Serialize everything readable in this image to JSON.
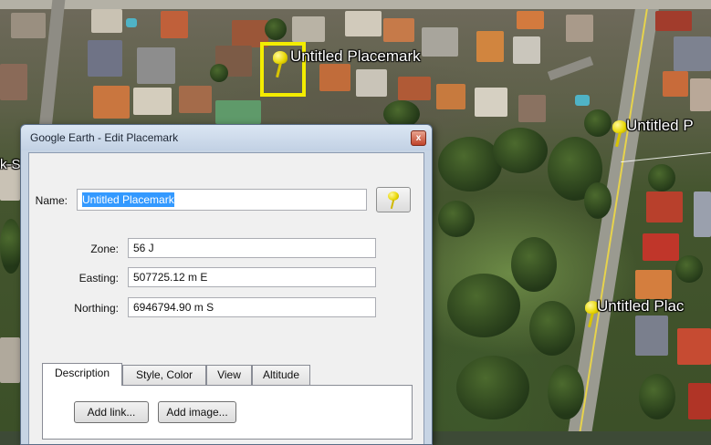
{
  "map": {
    "placemarks": [
      {
        "label": "Untitled Placemark"
      },
      {
        "label": "Untitled P"
      },
      {
        "label": "Untitled Plac"
      }
    ],
    "left_edge_label": "k-S"
  },
  "dialog": {
    "title": "Google Earth - Edit Placemark",
    "close_glyph": "x",
    "name_label": "Name:",
    "name_value": "Untitled Placemark",
    "zone_label": "Zone:",
    "zone_value": "56 J",
    "easting_label": "Easting:",
    "easting_value": "507725.12 m E",
    "northing_label": "Northing:",
    "northing_value": "6946794.90 m S",
    "tabs": [
      "Description",
      "Style, Color",
      "View",
      "Altitude"
    ],
    "active_tab": "Description",
    "add_link_label": "Add link...",
    "add_image_label": "Add image..."
  },
  "colors": {
    "pin_yellow": "#e7d600",
    "selection_box": "#f3ec00",
    "text_selection": "#3399ff"
  }
}
